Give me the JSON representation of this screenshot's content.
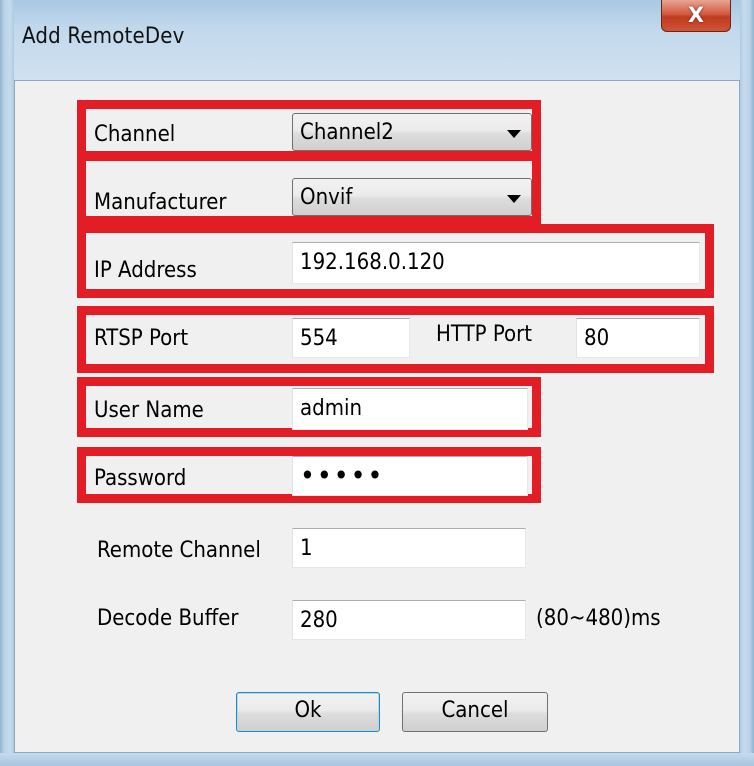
{
  "window": {
    "title": "Add RemoteDev",
    "close_label": "X"
  },
  "form": {
    "channel": {
      "label": "Channel",
      "value": "Channel2"
    },
    "manufacturer": {
      "label": "Manufacturer",
      "value": "Onvif"
    },
    "ip_address": {
      "label": "IP Address",
      "value": "192.168.0.120"
    },
    "rtsp_port": {
      "label": "RTSP Port",
      "value": "554"
    },
    "http_port": {
      "label": "HTTP Port",
      "value": "80"
    },
    "user_name": {
      "label": "User Name",
      "value": "admin"
    },
    "password": {
      "label": "Password",
      "value": "•••••"
    },
    "remote_channel": {
      "label": "Remote Channel",
      "value": "1"
    },
    "decode_buffer": {
      "label": "Decode Buffer",
      "value": "280",
      "unit": "(80~480)ms"
    }
  },
  "buttons": {
    "ok": "Ok",
    "cancel": "Cancel"
  },
  "colors": {
    "highlight": "#e21d26",
    "close_button": "#c9462a",
    "window_frame": "#c2d8ec"
  }
}
